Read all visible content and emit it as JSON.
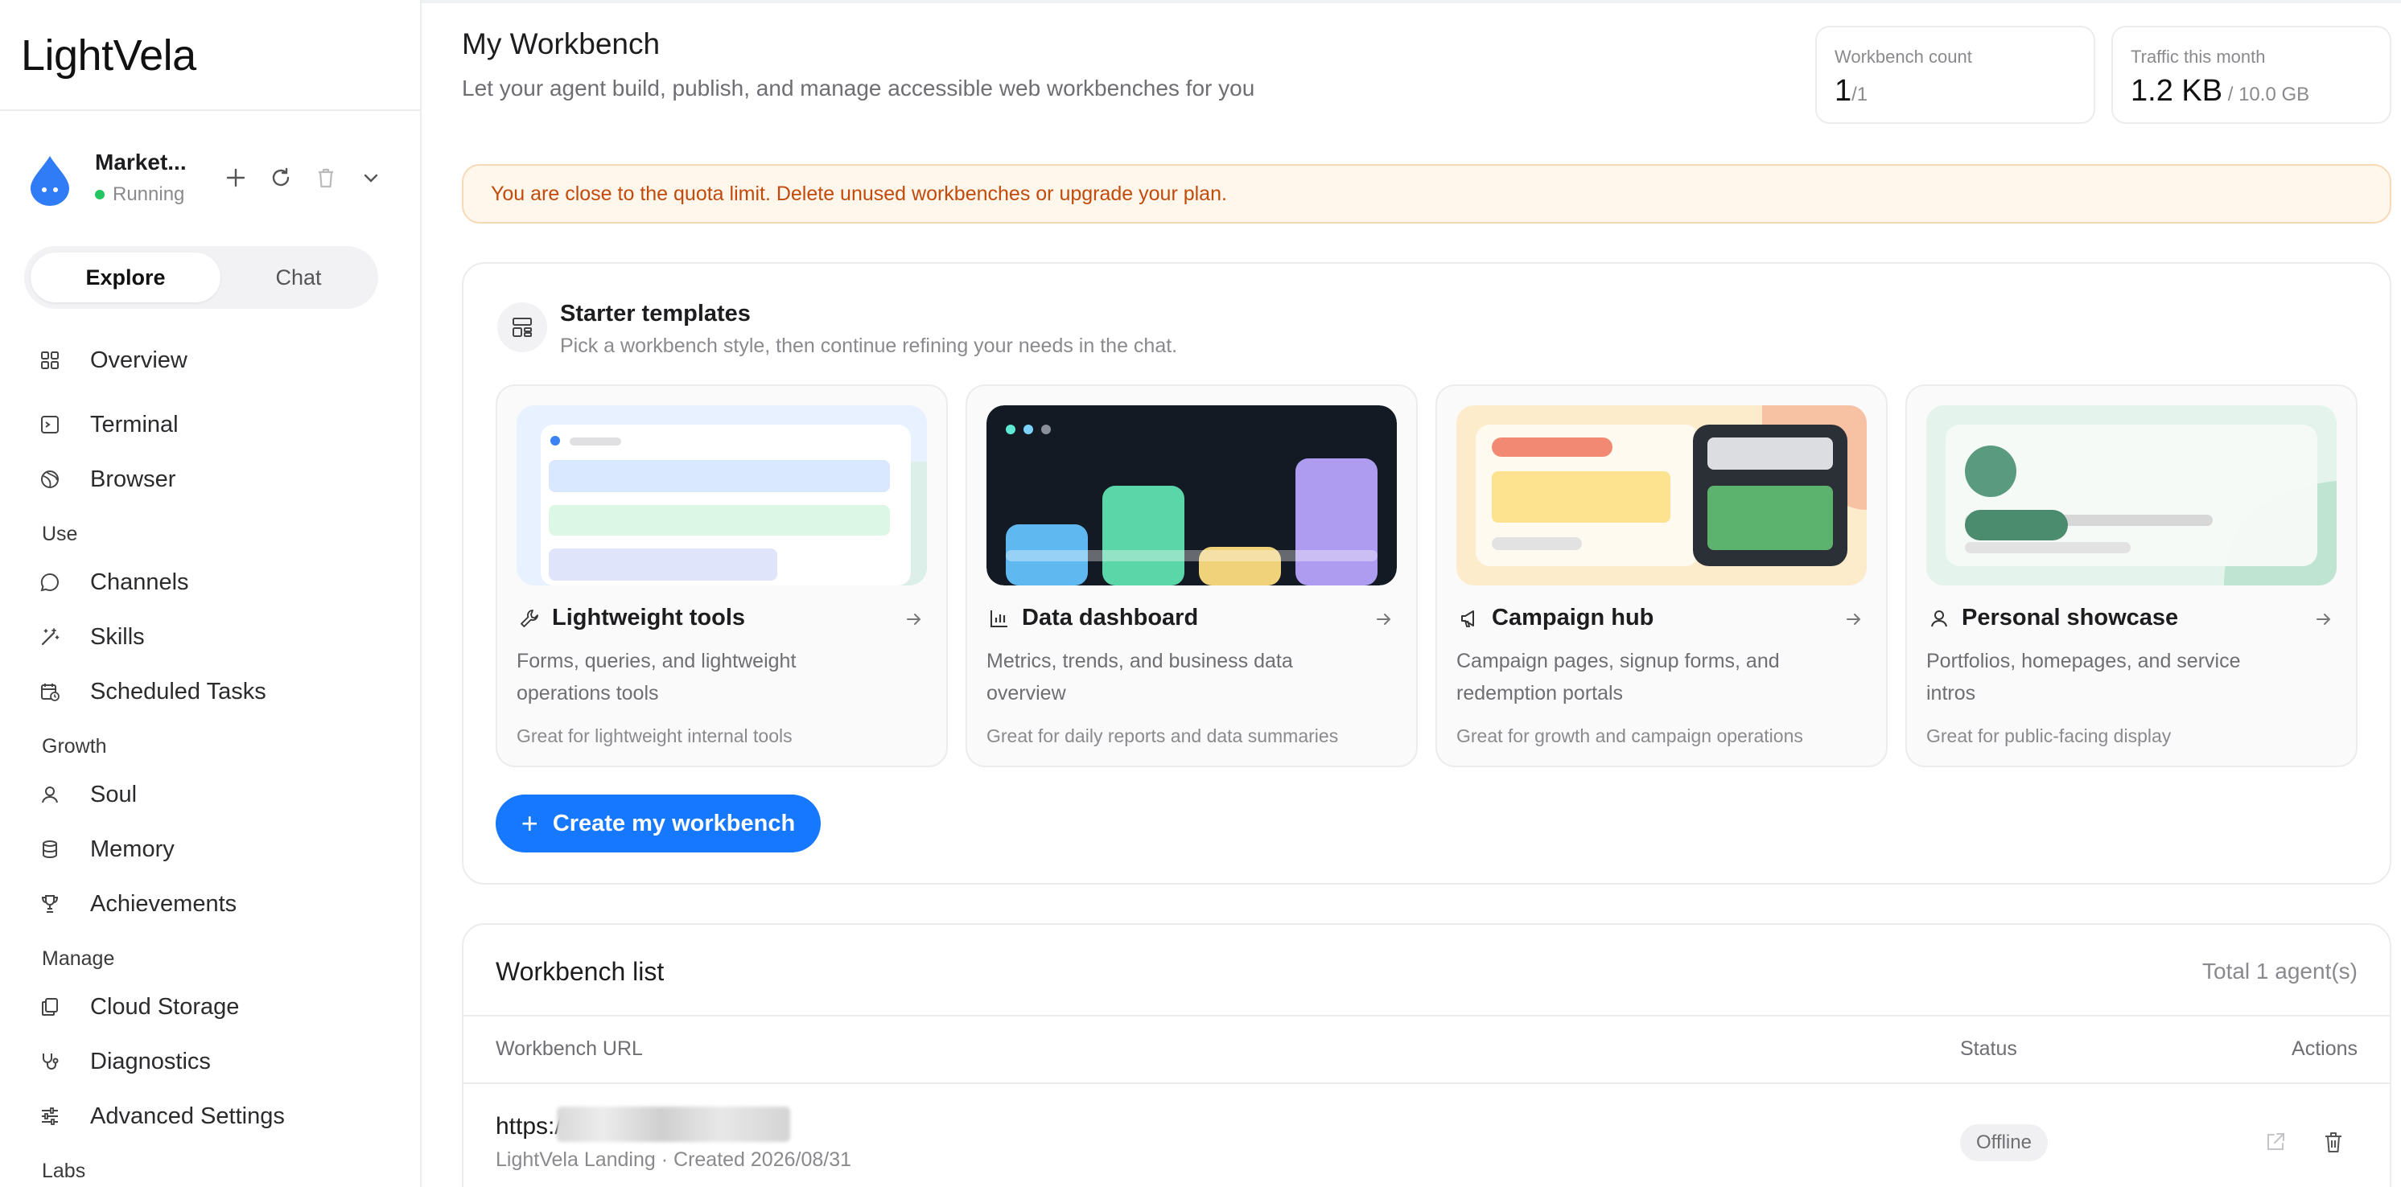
{
  "sidebar": {
    "logo": "LightVela",
    "agent": {
      "name": "Market...",
      "status": "Running"
    },
    "tabs": {
      "explore": "Explore",
      "chat": "Chat"
    },
    "items": {
      "overview": "Overview",
      "terminal": "Terminal",
      "browser": "Browser",
      "channels": "Channels",
      "skills": "Skills",
      "scheduled": "Scheduled Tasks",
      "soul": "Soul",
      "memory": "Memory",
      "achievements": "Achievements",
      "cloud": "Cloud Storage",
      "diagnostics": "Diagnostics",
      "advanced": "Advanced Settings"
    },
    "sections": {
      "use": "Use",
      "growth": "Growth",
      "manage": "Manage",
      "labs": "Labs"
    }
  },
  "header": {
    "title": "My Workbench",
    "subtitle": "Let your agent build, publish, and manage accessible web workbenches for you"
  },
  "stats": {
    "count": {
      "label": "Workbench count",
      "value": "1",
      "suffix": "/1"
    },
    "traffic": {
      "label": "Traffic this month",
      "value": "1.2 KB",
      "suffix": " / 10.0 GB"
    }
  },
  "alert": "You are close to the quota limit. Delete unused workbenches or upgrade your plan.",
  "starter": {
    "title": "Starter templates",
    "subtitle": "Pick a workbench style, then continue refining your needs in the chat.",
    "cards": [
      {
        "title": "Lightweight tools",
        "desc": "Forms, queries, and lightweight operations tools",
        "note": "Great for lightweight internal tools",
        "icon": "wrench-icon"
      },
      {
        "title": "Data dashboard",
        "desc": "Metrics, trends, and business data overview",
        "note": "Great for daily reports and data summaries",
        "icon": "bar-chart-icon"
      },
      {
        "title": "Campaign hub",
        "desc": "Campaign pages, signup forms, and redemption portals",
        "note": "Great for growth and campaign operations",
        "icon": "megaphone-icon"
      },
      {
        "title": "Personal showcase",
        "desc": "Portfolios, homepages, and service intros",
        "note": "Great for public-facing display",
        "icon": "user-icon"
      }
    ],
    "create_label": "Create my workbench"
  },
  "list": {
    "title": "Workbench list",
    "total": "Total 1 agent(s)",
    "columns": {
      "url": "Workbench URL",
      "status": "Status",
      "actions": "Actions"
    },
    "rows": [
      {
        "url": "https://w                                        ghtvela.site/",
        "meta": "LightVela Landing · Created 2026/08/31",
        "status": "Offline"
      }
    ]
  },
  "colors": {
    "accent": "#1677ff",
    "alert_text": "#c24a0a",
    "alert_bg": "#fff6ec",
    "running": "#22c55e"
  }
}
